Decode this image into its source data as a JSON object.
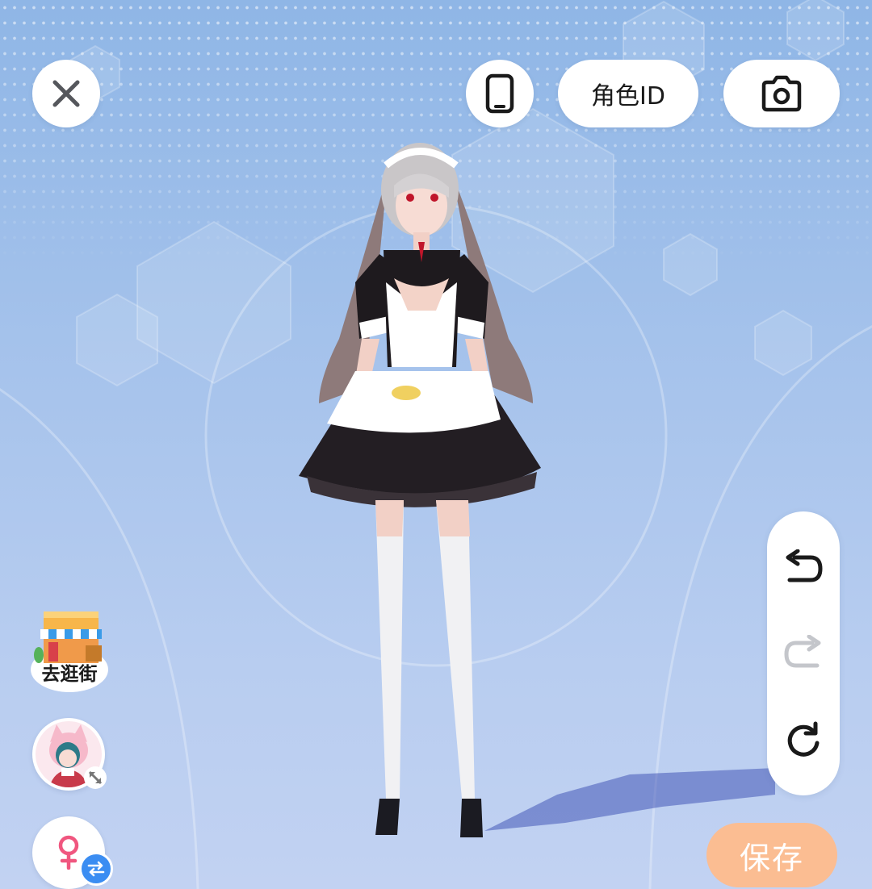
{
  "topbar": {
    "close_icon": "close-icon",
    "phone_icon": "phone-portrait-icon",
    "role_id_label": "角色ID",
    "camera_icon": "camera-icon"
  },
  "side_controls": {
    "undo_icon": "undo-icon",
    "redo_icon": "redo-icon",
    "redo_enabled": false,
    "reset_icon": "reset-rotate-icon"
  },
  "left_tools": {
    "street_label": "去逛街",
    "street_icon": "shop-storefront-icon",
    "avatar_icon": "avatar-portrait",
    "gender_icon": "female-icon",
    "swap_icon": "swap-icon"
  },
  "save": {
    "label": "保存",
    "color": "#fbbd92"
  },
  "colors": {
    "background_top": "#8fb6e6",
    "background_bottom": "#c2d2f2",
    "gender_pink": "#f0567f",
    "swap_blue": "#3b8df2"
  }
}
